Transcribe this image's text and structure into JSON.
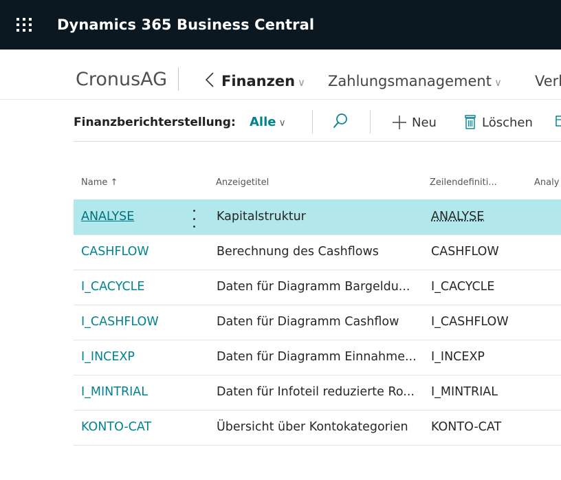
{
  "app": {
    "title": "Dynamics 365 Business Central"
  },
  "nav": {
    "company": "CronusAG",
    "back_glyph": "〈",
    "current": "Finanzen",
    "next": "Zahlungsmanagement",
    "partial": "Verk",
    "chevron": "∨"
  },
  "actionbar": {
    "page_label": "Finanzberichterstellung:",
    "filter_label": "Alle",
    "new_label": "Neu",
    "delete_label": "Löschen",
    "icons": [
      "search-icon",
      "plus-icon",
      "trash-icon"
    ]
  },
  "table": {
    "headers": {
      "name": "Name",
      "sort_indicator": "↑",
      "title": "Anzeigetitel",
      "rowdef": "Zeilendefiniti...",
      "analysis": "Analy"
    },
    "rows": [
      {
        "name": "ANALYSE",
        "title": "Kapitalstruktur",
        "rowdef": "ANALYSE",
        "selected": true
      },
      {
        "name": "CASHFLOW",
        "title": "Berechnung des Cashflows",
        "rowdef": "CASHFLOW"
      },
      {
        "name": "I_CACYCLE",
        "title": "Daten für Diagramm Bargeldu...",
        "rowdef": "I_CACYCLE"
      },
      {
        "name": "I_CASHFLOW",
        "title": "Daten für Diagramm Cashflow",
        "rowdef": "I_CASHFLOW"
      },
      {
        "name": "I_INCEXP",
        "title": "Daten für Diagramm Einnahme...",
        "rowdef": "I_INCEXP"
      },
      {
        "name": "I_MINTRIAL",
        "title": "Daten für Infoteil reduzierte Ro...",
        "rowdef": "I_MINTRIAL"
      },
      {
        "name": "KONTO-CAT",
        "title": "Übersicht über Kontokategorien",
        "rowdef": "KONTO-CAT"
      }
    ]
  },
  "colors": {
    "appbar": "#0b1821",
    "accent": "#00838f",
    "selected_row": "#b2e8ec"
  }
}
